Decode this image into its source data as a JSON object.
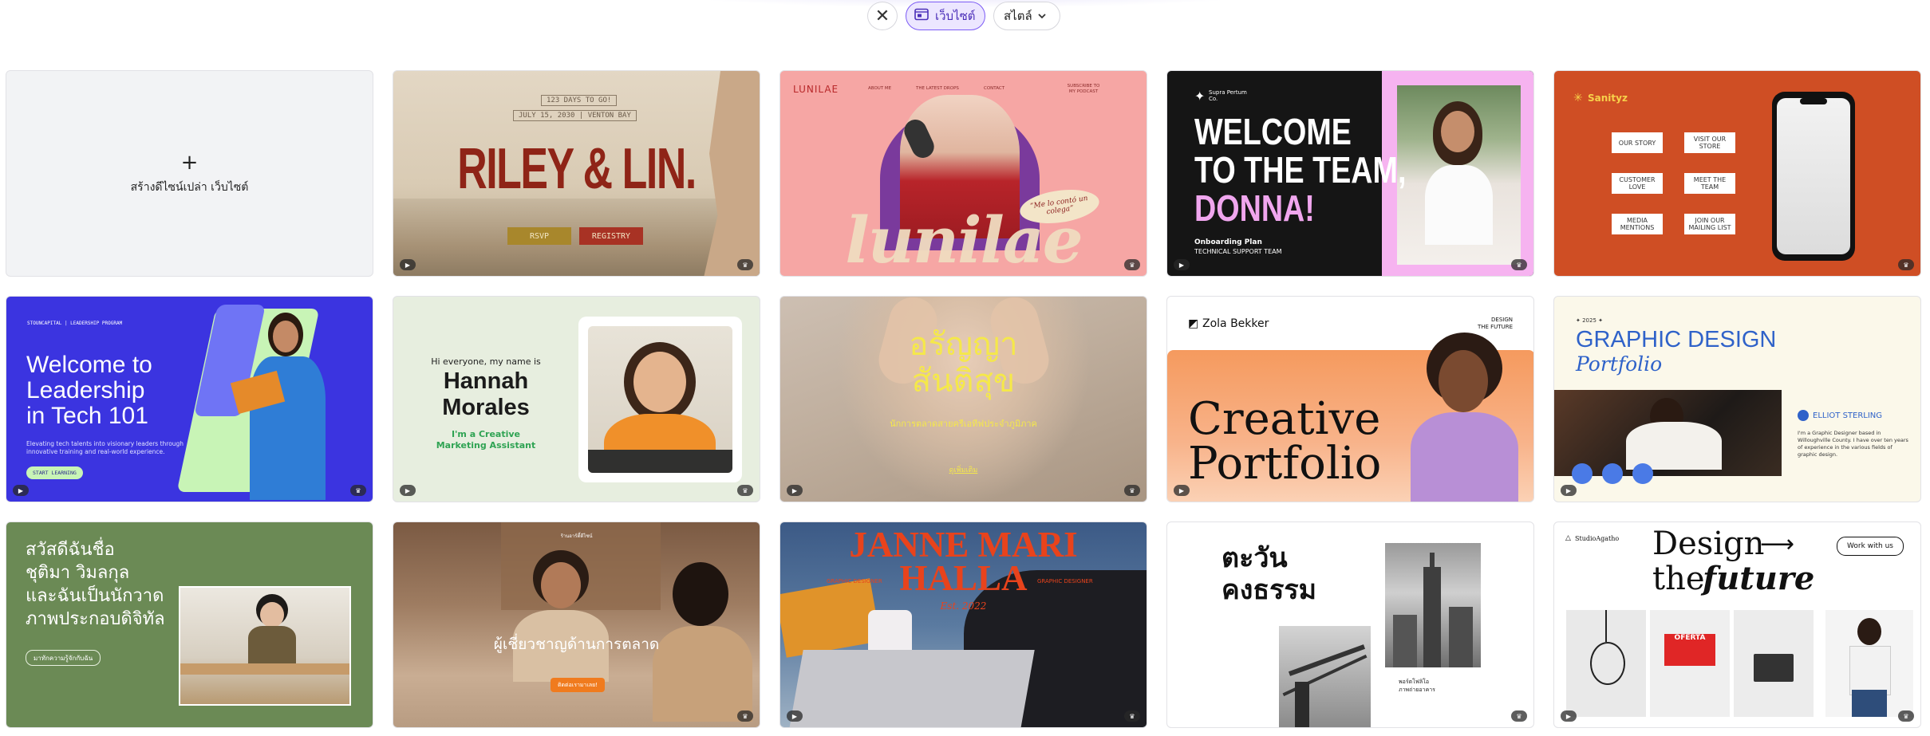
{
  "toolbar": {
    "close_symbol": "✕",
    "website_chip": "เว็บไซต์",
    "style_chip": "สไตล์",
    "accent": "#7d5cf5"
  },
  "blank": {
    "plus": "+",
    "label": "สร้างดีไซน์เปล่า เว็บไซต์"
  },
  "riley": {
    "days": "123 DAYS TO GO!",
    "date": "JULY 15, 2030 | VENTON BAY",
    "title": "RILEY & LIN.",
    "rsvp": "RSVP",
    "registry": "REGISTRY"
  },
  "lunilae": {
    "logo": "LUNILAE",
    "nav1": "ABOUT ME",
    "nav2": "THE LATEST DROPS",
    "nav3": "CONTACT",
    "nav4": "SUBSCRIBE TO MY PODCAST",
    "quote": "“Me lo contó un colega”",
    "script": "lunilae"
  },
  "welcome": {
    "brand": "Supra Pertum Co.",
    "line1": "WELCOME",
    "line2": "TO THE TEAM,",
    "line3": "DONNA!",
    "plan": "Onboarding Plan",
    "team": "TECHNICAL SUPPORT TEAM"
  },
  "sanityz": {
    "logo": "Sanityz",
    "b1": "OUR STORY",
    "b2": "VISIT OUR STORE",
    "b3": "CUSTOMER LOVE",
    "b4": "MEET THE TEAM",
    "b5": "MEDIA MENTIONS",
    "b6": "JOIN OUR MAILING LIST"
  },
  "leadership": {
    "org": "STOUNCAPITAL | LEADERSHIP PROGRAM",
    "title1": "Welcome to",
    "title2": "Leadership",
    "title3": "in Tech 101",
    "desc": "Elevating tech talents into visionary leaders through innovative training and real-world experience.",
    "button": "START LEARNING"
  },
  "hannah": {
    "greeting": "Hi everyone, my name is",
    "name1": "Hannah",
    "name2": "Morales",
    "role1": "I'm a Creative",
    "role2": "Marketing Assistant"
  },
  "thai_name": {
    "line1": "อรัญญา",
    "line2": "สันติสุข",
    "sub": "นักการตลาดสายครีเอทีฟประจำภูมิภาค",
    "link": "ดูเพิ่มเติม"
  },
  "zola": {
    "brand": "Zola Bekker",
    "tag1": "DESIGN",
    "tag2": "THE FUTURE",
    "title1": "Creative",
    "title2": "Portfolio"
  },
  "graphic": {
    "year": "✦ 2025 ✦",
    "title": "GRAPHIC DESIGN",
    "sub": "Portfolio",
    "person": "ELLIOT STERLING",
    "bio": "I'm a Graphic Designer based in Willoughville County. I have over ten years of experience in the various fields of graphic design."
  },
  "thai_intro": {
    "l1": "สวัสดีฉันชื่อ",
    "l2": "ชุติมา วิมลกุล",
    "l3": "และฉันเป็นนักวาด",
    "l4": "ภาพประกอบดิจิทัล",
    "button": "มาทักความรู้จักกับฉัน"
  },
  "market": {
    "top": "ร้านอาร์ตี้ดีไซน์",
    "title": "ผู้เชี่ยวชาญด้านการตลาด",
    "button": "ติดต่อเรามาเลย!"
  },
  "janne": {
    "line1": "JANNE MARI",
    "line2": "HALLA",
    "left": "GRAPHIC DESIGNER",
    "right": "GRAPHIC DESIGNER",
    "est": "Est. 2022"
  },
  "tawan": {
    "line1": "ตะวัน",
    "line2": "คงธรรม",
    "caption1": "พอร์ตโฟลิโอ",
    "caption2": "ภาพถ่ายอาคาร"
  },
  "studio": {
    "brand": "StudioAgatho",
    "title1": "Design",
    "title2": "the",
    "title2i": "future",
    "arrow": "⟶",
    "button": "Work with us",
    "sign": "OFERTA"
  }
}
